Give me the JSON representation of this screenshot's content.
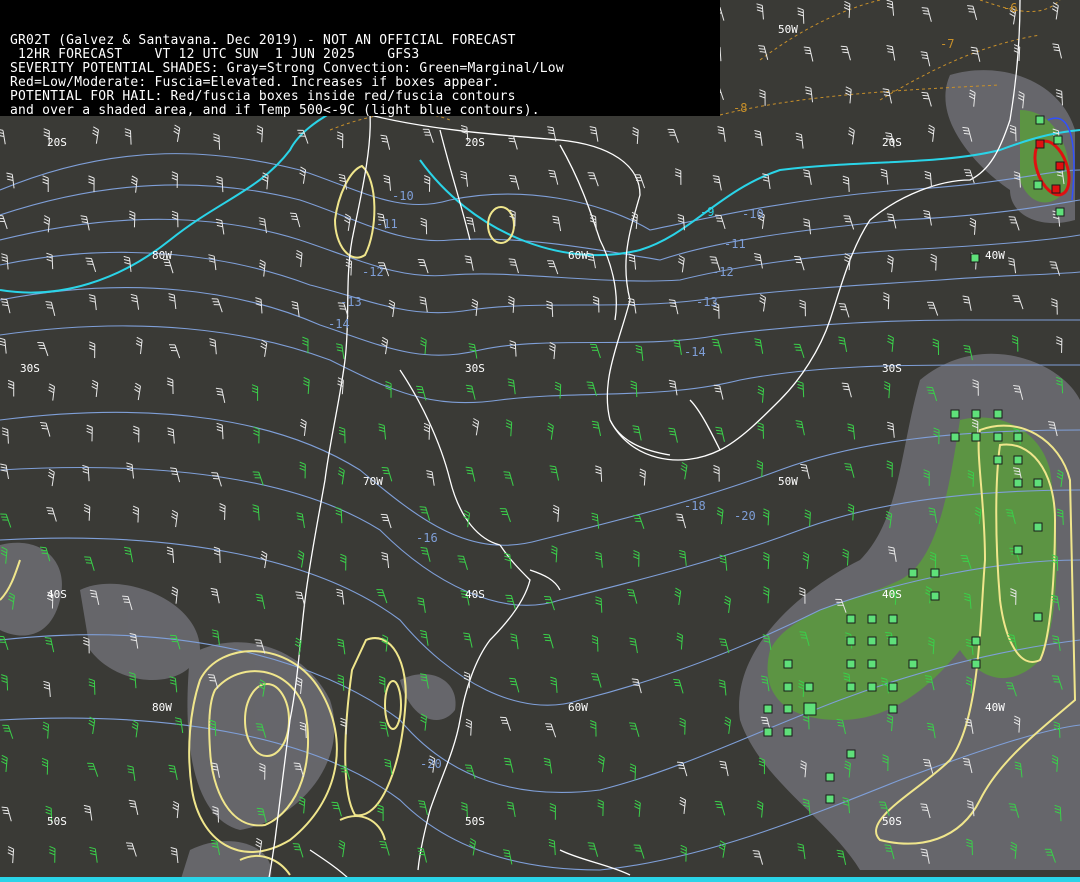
{
  "header": {
    "lines": [
      "GR02T (Galvez & Santavana. Dec 2019) - NOT AN OFFICIAL FORECAST",
      " 12HR FORECAST    VT 12 UTC SUN  1 JUN 2025    GFS3",
      "SEVERITY POTENTIAL SHADES: Gray=Strong Convection: Green=Marginal/Low",
      "Red=Low/Moderate: Fuscia=Elevated. Increases if boxes appear.",
      "POTENTIAL FOR HAIL: Red/fuscia boxes inside red/fuscia contours",
      "and over a shaded area, and if Temp 500<-9C (light blue contours)."
    ]
  },
  "grid_labels": {
    "lat_20s": [
      "20S",
      "20S",
      "20S"
    ],
    "lat_30s": [
      "30S",
      "30S",
      "30S"
    ],
    "lat_40s": [
      "40S",
      "40S",
      "40S"
    ],
    "lat_50s": [
      "50S",
      "50S",
      "50S"
    ],
    "lon_row1": [
      "80W",
      "60W",
      "50W",
      "40W"
    ],
    "lon_row2": [
      "70W",
      "50W"
    ],
    "lon_row3": [
      "80W",
      "60W",
      "40W"
    ]
  },
  "temp_labels": [
    "-6",
    "-7",
    "-8",
    "-9",
    "-10",
    "-10",
    "-11",
    "-11",
    "-12",
    "-12",
    "-13",
    "-13",
    "-14",
    "-14",
    "-16",
    "-18",
    "-20",
    "-20"
  ],
  "colors": {
    "background": "#3a3a36",
    "coast": "#ffffff",
    "temp_contour": "#7f9fd8",
    "cold_contour": "#2ad4e8",
    "severity_green": "#5aa03a",
    "severity_gray": "#6e6e74",
    "yellow_contour": "#f0e68c",
    "red_contour": "#e01010",
    "box_green": "#5fe07a",
    "wind_barb_white": "#e8e8e8",
    "wind_barb_green": "#3ad04a",
    "dashed_orange": "#c8902a"
  }
}
